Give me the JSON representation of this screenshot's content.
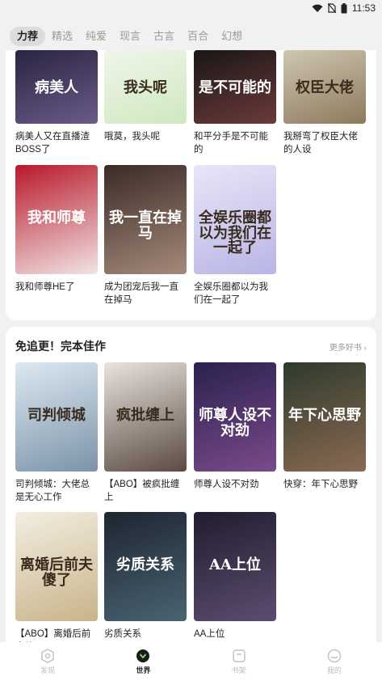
{
  "status": {
    "time": "11:53"
  },
  "tabs": [
    "力荐",
    "精选",
    "纯爱",
    "现言",
    "古言",
    "百合",
    "幻想"
  ],
  "section1": {
    "books": [
      {
        "title": "病美人又在直播渣BOSS了",
        "cover_text": "病美人",
        "c1": "#2a2440",
        "c2": "#6a5b8a"
      },
      {
        "title": "哦莫，我头呢",
        "cover_text": "我头呢",
        "c1": "#f0f6ea",
        "c2": "#cfe8c0"
      },
      {
        "title": "和平分手是不可能的",
        "cover_text": "是不可能的",
        "c1": "#1a1616",
        "c2": "#6b3a3a"
      },
      {
        "title": "我掰弯了权臣大佬的人设",
        "cover_text": "权臣大佬",
        "c1": "#cfc6b2",
        "c2": "#8c7a5c"
      },
      {
        "title": "我和师尊HE了",
        "cover_text": "我和师尊",
        "c1": "#b8182a",
        "c2": "#f1e4e4"
      },
      {
        "title": "成为团宠后我一直在掉马",
        "cover_text": "我一直在掉马",
        "c1": "#3a2a26",
        "c2": "#a58a7a"
      },
      {
        "title": "全娱乐圈都以为我们在一起了",
        "cover_text": "全娱乐圈都以为我们在一起了",
        "c1": "#e8e6f7",
        "c2": "#b9b4e6"
      }
    ]
  },
  "section2": {
    "title": "免追更！完本佳作",
    "more": "更多好书 ›",
    "books": [
      {
        "title": "司判倾城：大佬总是无心工作",
        "cover_text": "司判倾城",
        "c1": "#dde9f2",
        "c2": "#7b93a8"
      },
      {
        "title": "【ABO】被疯批缠上",
        "cover_text": "疯批缠上",
        "c1": "#e9e4dd",
        "c2": "#5a4a42"
      },
      {
        "title": "师尊人设不对劲",
        "cover_text": "师尊人设不对劲",
        "c1": "#2b2150",
        "c2": "#7a4a8a"
      },
      {
        "title": "快穿：年下心思野",
        "cover_text": "年下心思野",
        "c1": "#2e3a2c",
        "c2": "#8a6a52"
      },
      {
        "title": "【ABO】离婚后前夫傻了",
        "cover_text": "离婚后前夫傻了",
        "c1": "#f3eee2",
        "c2": "#c9b48a"
      },
      {
        "title": "劣质关系",
        "cover_text": "劣质关系",
        "c1": "#1d2530",
        "c2": "#4a6372"
      },
      {
        "title": "AA上位",
        "cover_text": "AA上位",
        "c1": "#221c2e",
        "c2": "#5b4d70"
      }
    ]
  },
  "nav": [
    {
      "label": "发现",
      "icon": "compass-icon"
    },
    {
      "label": "世界",
      "icon": "world-icon"
    },
    {
      "label": "书架",
      "icon": "bookshelf-icon"
    },
    {
      "label": "我的",
      "icon": "profile-icon"
    }
  ]
}
